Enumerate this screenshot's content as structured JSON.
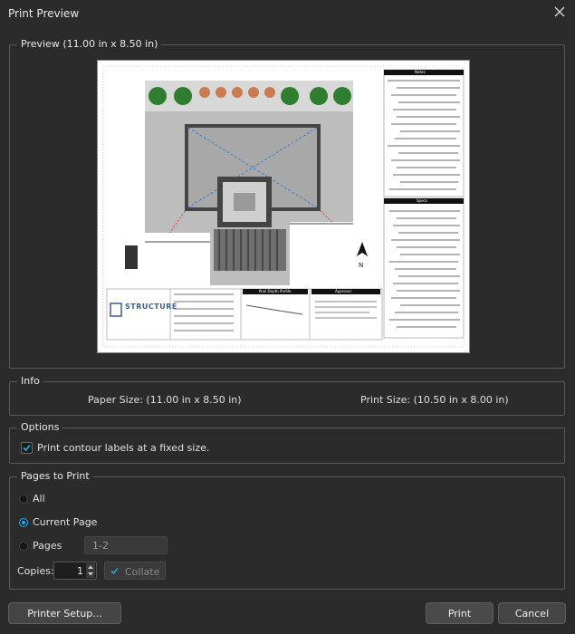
{
  "window": {
    "title": "Print Preview"
  },
  "preview": {
    "legend": "Preview (11.00 in x 8.50 in)",
    "sheet": {
      "logo_text": "STRUCTURE",
      "panel_notes_title": "Notes",
      "panel_specs_title": "Specs",
      "profile_title": "Pool Depth Profile",
      "approval_title": "Approval"
    }
  },
  "info": {
    "legend": "Info",
    "paper_size": "Paper Size: (11.00 in x 8.50 in)",
    "print_size": "Print Size: (10.50 in x 8.00 in)"
  },
  "options": {
    "legend": "Options",
    "fixed_labels": "Print contour labels at a fixed size."
  },
  "pages_to_print": {
    "legend": "Pages to Print",
    "all": "All",
    "current_page": "Current Page",
    "pages": "Pages",
    "pages_range": "1-2",
    "copies_label": "Copies:",
    "copies_value": "1",
    "collate": "Collate"
  },
  "buttons": {
    "printer_setup": "Printer Setup...",
    "print": "Print",
    "cancel": "Cancel"
  },
  "colors": {
    "background": "#2b2b2b",
    "accent": "#18b0ff",
    "border": "#5a5a5a"
  }
}
